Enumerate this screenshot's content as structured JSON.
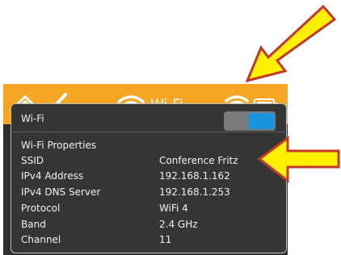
{
  "topbar": {
    "title": "Wi-Fi",
    "home_icon": "home-icon",
    "back_icon": "chevron-left-icon",
    "wifi_title_icon": "wifi-icon",
    "wifi_status_icon": "wifi-icon",
    "battery_icon": "battery-icon",
    "color": "#f5a623"
  },
  "wifi_toggle": {
    "label": "Wi-Fi",
    "state": "on",
    "on_color": "#1a94df"
  },
  "properties": {
    "section_title": "Wi-Fi Properties",
    "rows": [
      {
        "label": "SSID",
        "value": "Conference Fritz"
      },
      {
        "label": "IPv4 Address",
        "value": "192.168.1.162"
      },
      {
        "label": "IPv4 DNS Server",
        "value": "192.168.1.253"
      },
      {
        "label": "Protocol",
        "value": "WiFi 4"
      },
      {
        "label": "Band",
        "value": "2.4 GHz"
      },
      {
        "label": "Channel",
        "value": "11"
      }
    ]
  },
  "annotations": {
    "arrow_color": "#ffef00",
    "arrow_outline": "#c0392b"
  }
}
